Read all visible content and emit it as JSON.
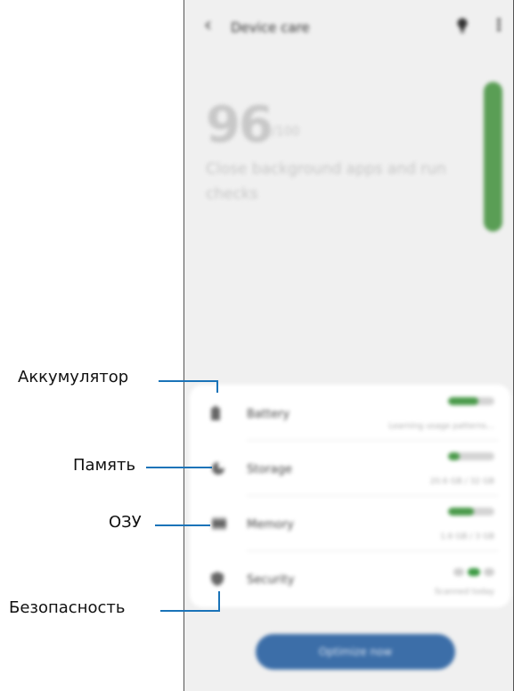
{
  "header": {
    "title": "Device care",
    "back_icon": "chevron-left-icon",
    "bulb_icon": "lightbulb-icon",
    "more_icon": "more-vertical-icon"
  },
  "score": {
    "value": "96",
    "unit": "/100",
    "description": "Close background apps and run checks",
    "level": 0.96
  },
  "items": [
    {
      "key": "battery",
      "label": "Battery",
      "sub": "Learning usage patterns…",
      "icon": "battery-icon",
      "level": 0.65
    },
    {
      "key": "storage",
      "label": "Storage",
      "sub": "20.6 GB / 32 GB",
      "icon": "storage-pie-icon",
      "level": 0.25
    },
    {
      "key": "memory",
      "label": "Memory",
      "sub": "1.6 GB / 3 GB",
      "icon": "memory-chip-icon",
      "level": 0.55
    },
    {
      "key": "security",
      "label": "Security",
      "sub": "Scanned today",
      "icon": "shield-icon"
    }
  ],
  "action_button": "Optimize now",
  "callouts": {
    "battery": "Аккумулятор",
    "storage": "Память",
    "memory": "ОЗУ",
    "security": "Безопасность"
  },
  "colors": {
    "accent_green": "#4a9a4a",
    "button_blue": "#3c6ea8",
    "callout_line": "#1a73b8"
  }
}
